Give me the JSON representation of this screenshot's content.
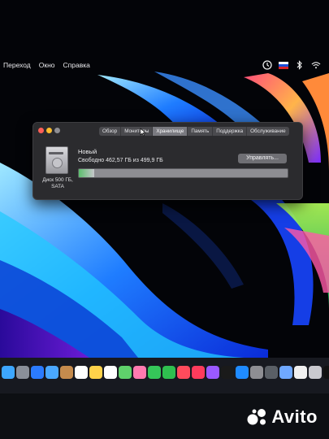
{
  "menubar": {
    "items": [
      "Переход",
      "Окно",
      "Справка"
    ],
    "status_icons": [
      "time-machine-icon",
      "flag-ru-icon",
      "bluetooth-icon",
      "wifi-icon"
    ]
  },
  "window": {
    "tabs": [
      "Обзор",
      "Мониторы",
      "Хранилище",
      "Память",
      "Поддержка",
      "Обслуживание"
    ],
    "active_tab": "Хранилище",
    "disk_label_line1": "Диск 500 ГБ,",
    "disk_label_line2": "SATA",
    "volume_name": "Новый",
    "free_space": "Свободно 462,57 ГБ из 499,9 ГБ",
    "manage_button": "Управлять...",
    "used_fraction": 0.075,
    "colors": {
      "close": "#ff5f57",
      "minimize": "#febc2e",
      "zoom": "#8e8e93"
    }
  },
  "dock": {
    "icons": [
      "finder-icon",
      "launchpad-icon",
      "safari-icon",
      "mail-icon",
      "contacts-icon",
      "calendar-icon",
      "notes-icon",
      "reminders-icon",
      "maps-icon",
      "photos-icon",
      "messages-icon",
      "facetime-icon",
      "news-icon",
      "music-icon",
      "podcasts-icon",
      "tv-icon",
      "appstore-icon",
      "settings-icon",
      "system-info-icon",
      "preview-icon",
      "textedit-icon",
      "script-icon",
      "terminal-icon",
      "whatsapp-icon",
      "excel-icon",
      "grid-icon",
      "camera-icon",
      "trash-icon"
    ]
  },
  "watermark": {
    "brand": "Avito"
  }
}
